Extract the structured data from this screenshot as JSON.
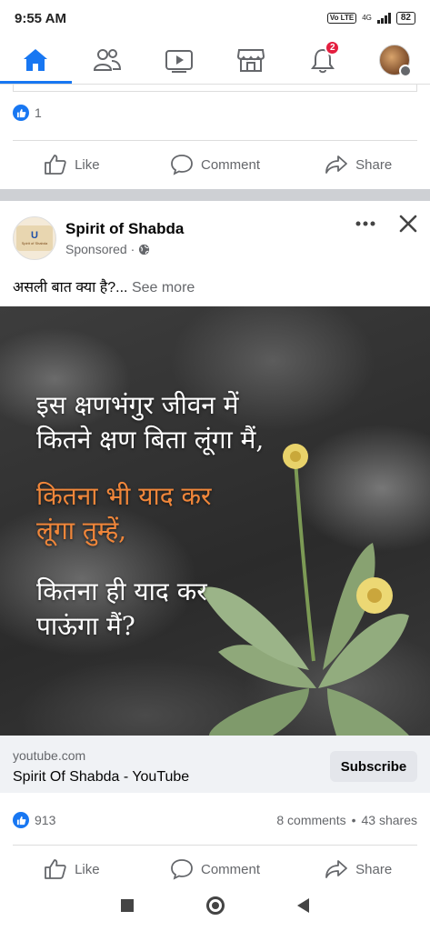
{
  "status_bar": {
    "time": "9:55 AM",
    "volte": "Vo LTE",
    "network": "4G",
    "battery": "82"
  },
  "nav": {
    "items": [
      {
        "icon": "home-icon",
        "active": true
      },
      {
        "icon": "friends-icon",
        "active": false
      },
      {
        "icon": "video-icon",
        "active": false
      },
      {
        "icon": "marketplace-icon",
        "active": false
      },
      {
        "icon": "bell-icon",
        "active": false,
        "badge": "2"
      },
      {
        "icon": "profile-menu-icon",
        "active": false
      }
    ],
    "accent_color": "#1877f2"
  },
  "previous_post": {
    "like_count": "1",
    "actions": {
      "like": "Like",
      "comment": "Comment",
      "share": "Share"
    }
  },
  "sponsored_post": {
    "page_name": "Spirit of Shabda",
    "sponsored_label": "Sponsored ·",
    "text": "असली बात क्या है?...",
    "see_more": "See more",
    "image_text": {
      "line1": "इस क्षणभंगुर जीवन में",
      "line2": "कितने क्षण बिता लूंगा मैं,",
      "line3": "कितना भी याद कर",
      "line4": "लूंगा तुम्हें,",
      "line5": "कितना ही याद कर",
      "line6": "पाऊंगा मैं?"
    },
    "link": {
      "domain": "youtube.com",
      "title": "Spirit Of Shabda - YouTube",
      "cta": "Subscribe"
    },
    "likes": "913",
    "comments": "8 comments",
    "shares": "43 shares",
    "separator": "•",
    "actions": {
      "like": "Like",
      "comment": "Comment",
      "share": "Share"
    }
  }
}
